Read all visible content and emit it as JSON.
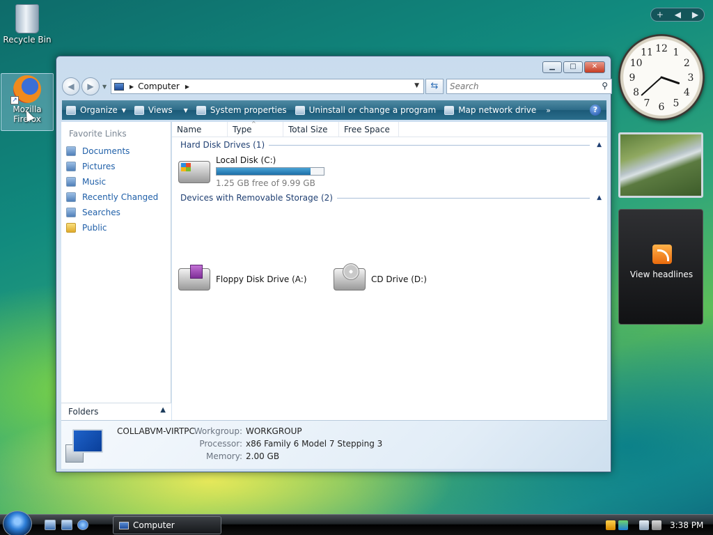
{
  "desktop": {
    "icons": [
      {
        "label": "Recycle Bin",
        "icon": "recycle-bin-icon"
      },
      {
        "label": "Mozilla Firefox",
        "icon": "firefox-icon"
      }
    ]
  },
  "window": {
    "controls": {
      "minimize": "▁",
      "maximize": "□",
      "close": "✕"
    },
    "nav": {
      "back": "◀",
      "forward": "▶",
      "dropdown": "▼"
    },
    "address": {
      "location": "Computer",
      "separator": "▶"
    },
    "refresh_glyph": "⇆",
    "search": {
      "placeholder": "Search",
      "icon": "search-icon"
    },
    "toolbar": {
      "items": [
        {
          "label": "Organize",
          "has_menu": true,
          "icon": "organize-icon"
        },
        {
          "label": "Views",
          "has_menu": true,
          "icon": "views-icon"
        },
        {
          "label": "System properties",
          "icon": "system-properties-icon"
        },
        {
          "label": "Uninstall or change a program",
          "icon": "uninstall-icon"
        },
        {
          "label": "Map network drive",
          "icon": "map-network-drive-icon"
        }
      ],
      "more": "»",
      "help": "?"
    },
    "favorite_links": {
      "heading": "Favorite Links",
      "items": [
        "Documents",
        "Pictures",
        "Music",
        "Recently Changed",
        "Searches",
        "Public"
      ]
    },
    "folders_label": "Folders",
    "columns": [
      "Name",
      "Type",
      "Total Size",
      "Free Space"
    ],
    "groups": [
      {
        "title": "Hard Disk Drives (1)",
        "drives": [
          {
            "name": "Local Disk (C:)",
            "free_text": "1.25 GB free of 9.99 GB",
            "used_fraction": 0.875
          }
        ]
      },
      {
        "title": "Devices with Removable Storage (2)",
        "drives": [
          {
            "name": "Floppy Disk Drive (A:)"
          },
          {
            "name": "CD Drive (D:)"
          }
        ]
      }
    ],
    "details": {
      "computer_name": "COLLABVM-VIRTPC",
      "rows": [
        {
          "label": "Workgroup:",
          "value": "WORKGROUP"
        },
        {
          "label": "Processor:",
          "value": "x86 Family 6 Model 7 Stepping 3"
        },
        {
          "label": "Memory:",
          "value": "2.00 GB"
        }
      ]
    }
  },
  "gadgets": {
    "bar": {
      "add": "+",
      "prev": "◀",
      "next": "▶"
    },
    "clock": {
      "numbers": [
        "12",
        "1",
        "2",
        "3",
        "4",
        "5",
        "6",
        "7",
        "8",
        "9",
        "10",
        "11"
      ],
      "hour": 3,
      "minute": 38
    },
    "feed_label": "View headlines"
  },
  "taskbar": {
    "task_label": "Computer",
    "time": "3:38 PM"
  },
  "colors": {
    "accent": "#1f5fa8",
    "toolbar": "#2c6b88"
  }
}
